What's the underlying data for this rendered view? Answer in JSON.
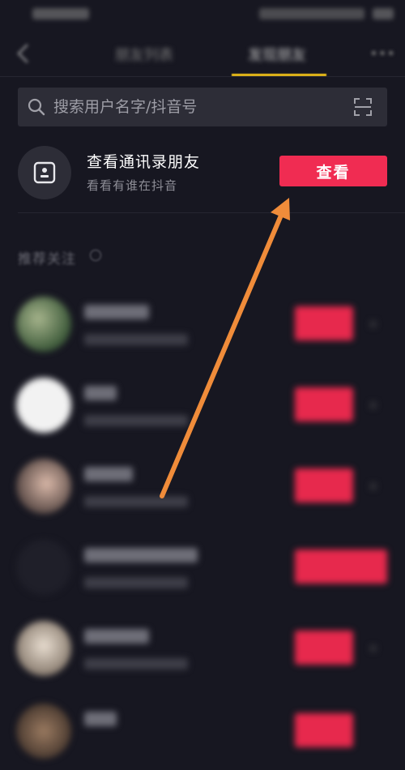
{
  "nav": {
    "tabs": [
      "朋友列表",
      "发现朋友"
    ],
    "active_tab": 1
  },
  "search": {
    "placeholder": "搜索用户名字/抖音号"
  },
  "contacts": {
    "title": "查看通讯录朋友",
    "subtitle": "看看有谁在抖音",
    "button_label": "查看"
  },
  "recommend": {
    "header": "推荐关注"
  },
  "colors": {
    "background": "#171721",
    "accent_red": "#f02c52",
    "tab_underline": "#f5c518",
    "annotation_arrow": "#f08c3a"
  }
}
